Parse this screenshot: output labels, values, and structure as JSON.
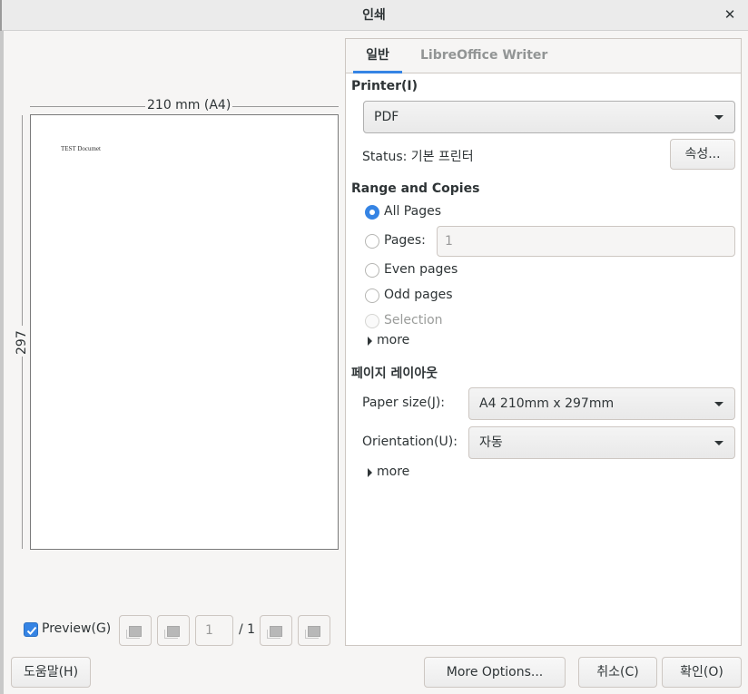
{
  "window": {
    "title": "인쇄",
    "close_glyph": "✕"
  },
  "preview": {
    "paper_width_label": "210 mm (A4)",
    "paper_height_label": "297 mm",
    "document_text": "TEST Documet",
    "checkbox_label": "Preview(G)",
    "preview_checked": true,
    "current_page": "1",
    "total_pages": "/ 1"
  },
  "tabs": [
    {
      "label": "일반",
      "active": true
    },
    {
      "label": "LibreOffice Writer",
      "active": false
    }
  ],
  "printer": {
    "heading": "Printer(I)",
    "selected": "PDF",
    "status_label": "Status:",
    "status_value": "기본 프린터",
    "properties_button": "속성..."
  },
  "range": {
    "heading": "Range and Copies",
    "options": [
      {
        "label": "All Pages",
        "checked": true,
        "enabled": true
      },
      {
        "label": "Pages:",
        "checked": false,
        "enabled": true
      },
      {
        "label": "Even pages",
        "checked": false,
        "enabled": true
      },
      {
        "label": "Odd pages",
        "checked": false,
        "enabled": true
      },
      {
        "label": "Selection",
        "checked": false,
        "enabled": false
      }
    ],
    "pages_value": "1",
    "more_label": "more"
  },
  "layout": {
    "heading": "페이지 레이아웃",
    "paper_size_label": "Paper size(J):",
    "paper_size_value": "A4 210mm x 297mm",
    "orientation_label": "Orientation(U):",
    "orientation_value": "자동",
    "more_label": "more"
  },
  "footer": {
    "help_button": "도움말(H)",
    "more_options_button": "More Options...",
    "cancel_button": "취소(C)",
    "ok_button": "확인(O)"
  },
  "colors": {
    "accent": "#3584e4",
    "background": "#f6f5f4"
  }
}
